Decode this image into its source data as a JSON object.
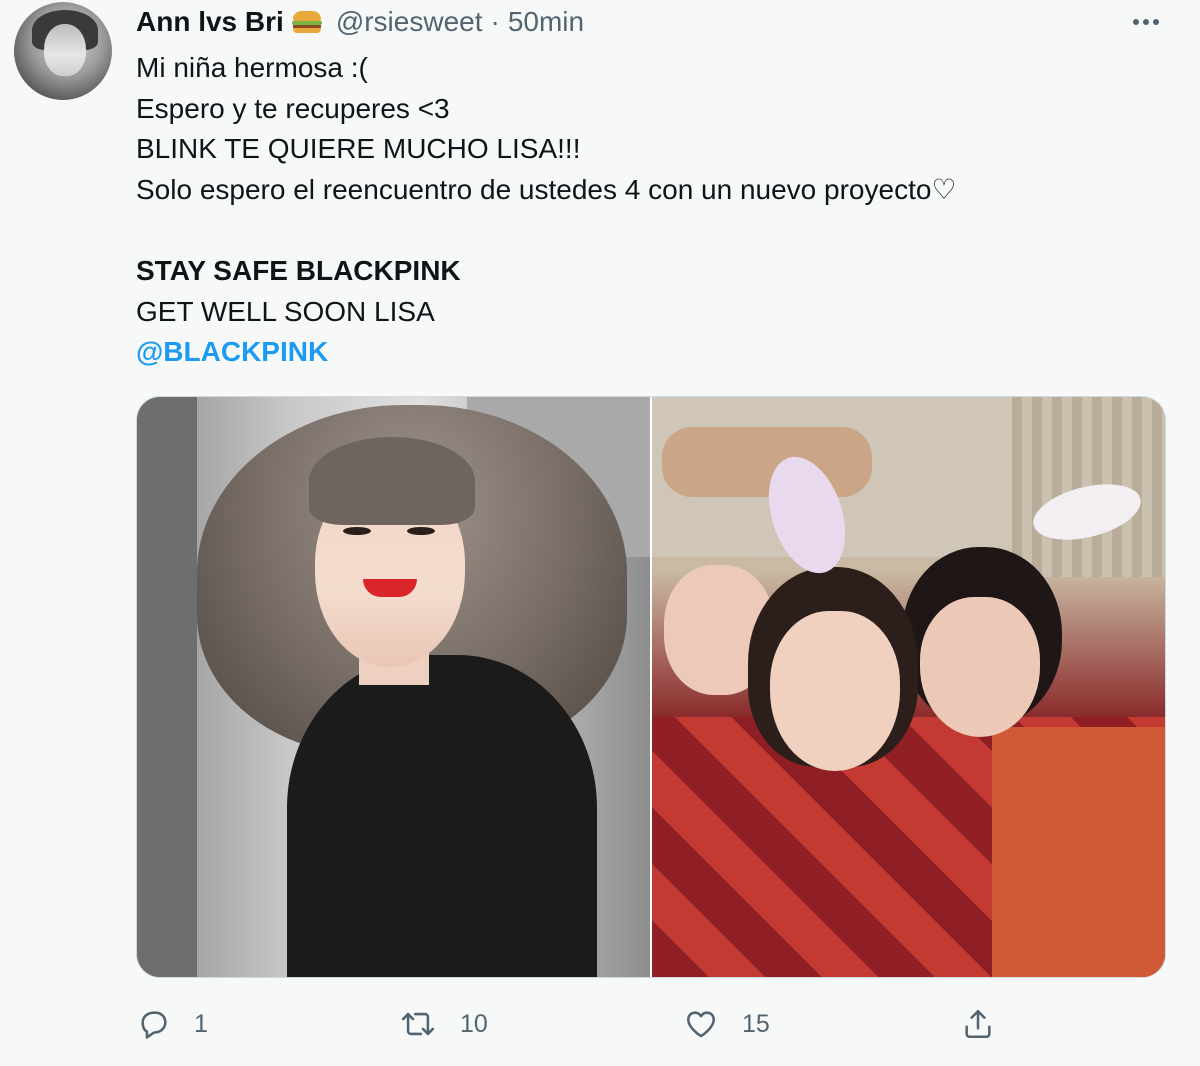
{
  "tweet": {
    "display_name": "Ann lvs Bri",
    "name_emoji": "burger-emoji",
    "handle": "@rsiesweet",
    "separator": "·",
    "time": "50min",
    "text_lines": [
      "Mi niña hermosa :(",
      "Espero y te recuperes <3",
      "BLINK TE QUIERE MUCHO LISA!!!",
      "Solo espero el reencuentro de ustedes 4 con un nuevo proyecto♡",
      "STAY SAFE BLACKPINK",
      "GET WELL SOON LISA",
      "@BLACKPINK"
    ],
    "media": [
      {
        "icon": "photo-woman-smiling-grey-hair"
      },
      {
        "icon": "photo-group-bunny-ears-red-sweater"
      }
    ],
    "actions": {
      "reply": {
        "icon": "reply-icon",
        "count": "1"
      },
      "retweet": {
        "icon": "retweet-icon",
        "count": "10"
      },
      "like": {
        "icon": "heart-icon",
        "count": "15"
      },
      "share": {
        "icon": "share-icon",
        "count": ""
      }
    }
  },
  "colors": {
    "background": "#f7f9f9",
    "text": "#0f1419",
    "secondary_text": "#536471",
    "link": "#1d9bf0"
  }
}
